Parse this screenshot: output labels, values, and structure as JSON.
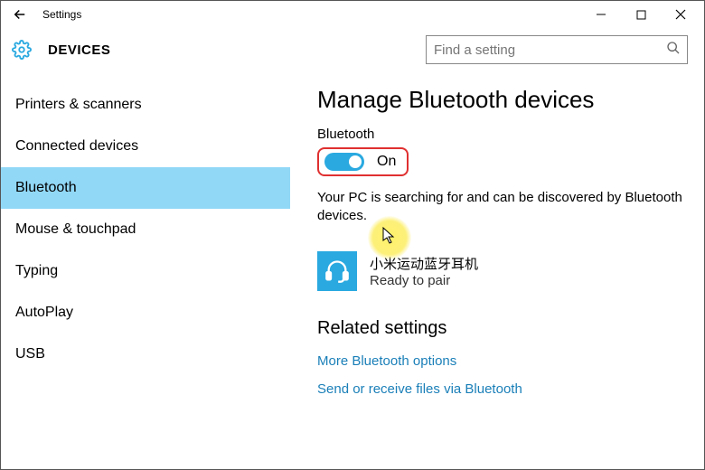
{
  "titlebar": {
    "title": "Settings"
  },
  "header": {
    "section": "DEVICES"
  },
  "search": {
    "placeholder": "Find a setting"
  },
  "sidebar": {
    "items": [
      {
        "label": "Printers & scanners",
        "active": false
      },
      {
        "label": "Connected devices",
        "active": false
      },
      {
        "label": "Bluetooth",
        "active": true
      },
      {
        "label": "Mouse & touchpad",
        "active": false
      },
      {
        "label": "Typing",
        "active": false
      },
      {
        "label": "AutoPlay",
        "active": false
      },
      {
        "label": "USB",
        "active": false
      }
    ]
  },
  "main": {
    "heading": "Manage Bluetooth devices",
    "toggle_label": "Bluetooth",
    "toggle_on": true,
    "toggle_state_text": "On",
    "description": "Your PC is searching for and can be discovered by Bluetooth devices.",
    "device": {
      "name": "小米运动蓝牙耳机",
      "status": "Ready to pair"
    },
    "related_heading": "Related settings",
    "links": [
      "More Bluetooth options",
      "Send or receive files via Bluetooth"
    ]
  }
}
